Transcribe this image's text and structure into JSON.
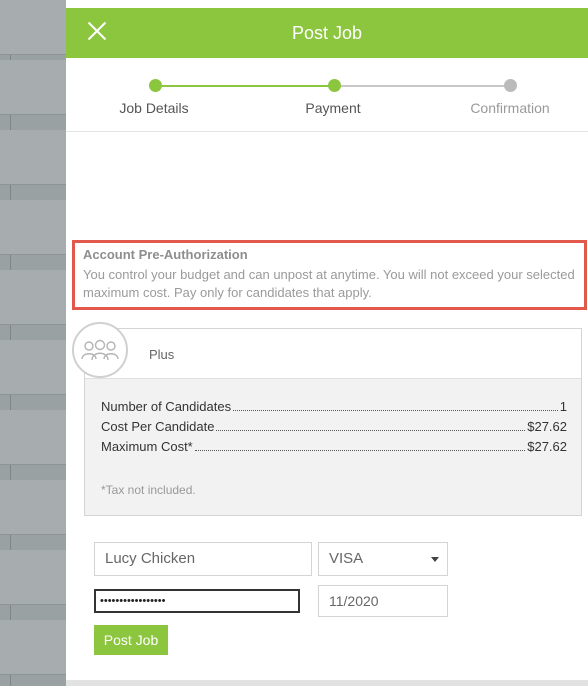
{
  "header": {
    "title": "Post Job"
  },
  "steps": [
    {
      "label": "Job Details",
      "state": "complete"
    },
    {
      "label": "Payment",
      "state": "current"
    },
    {
      "label": "Confirmation",
      "state": "pending"
    }
  ],
  "notice": {
    "title": "Account Pre-Authorization",
    "body": "You control your budget and can unpost at anytime. You will not exceed your selected maximum cost. Pay only for candidates that apply."
  },
  "plan": {
    "name": "Plus",
    "icon": "users-icon",
    "rows": [
      {
        "label": "Number of Candidates",
        "value": "1"
      },
      {
        "label": "Cost Per Candidate",
        "value": "$27.62"
      },
      {
        "label": "Maximum Cost*",
        "value": "$27.62"
      }
    ],
    "tax_note": "*Tax not included."
  },
  "payment": {
    "name_value": "Lucy Chicken",
    "card_type": "VISA",
    "card_number_masked": "•••••••••••••••••",
    "expiry": "11/2020",
    "submit_label": "Post Job"
  },
  "colors": {
    "accent": "#8cc63f",
    "highlight_border": "#e2594b",
    "pending": "#bbbbbb"
  }
}
